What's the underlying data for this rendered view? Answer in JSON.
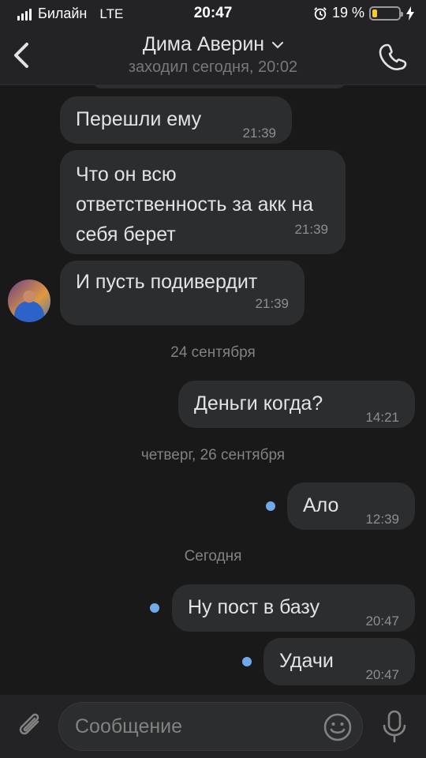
{
  "status_bar": {
    "carrier": "Билайн",
    "network": "LTE",
    "time": "20:47",
    "battery_percent": "19 %",
    "battery_level": 0.19
  },
  "header": {
    "title": "Дима Аверин",
    "subtitle": "заходил сегодня, 20:02"
  },
  "messages": [
    {
      "text": "Перешли ему",
      "time": "21:39",
      "direction": "incoming"
    },
    {
      "text": "Что он всю ответственность за акк на себя берет",
      "time": "21:39",
      "direction": "incoming"
    },
    {
      "text": "И пусть подивердит",
      "time": "21:39",
      "direction": "incoming"
    },
    {
      "date_label": "24 сентября"
    },
    {
      "text": "Деньги когда?",
      "time": "14:21",
      "direction": "outgoing"
    },
    {
      "date_label": "четверг, 26 сентября"
    },
    {
      "text": "Ало",
      "time": "12:39",
      "direction": "outgoing",
      "unread": true
    },
    {
      "date_label": "Сегодня"
    },
    {
      "text": "Ну пост в базу",
      "time": "20:47",
      "direction": "outgoing",
      "unread": true
    },
    {
      "text": "Удачи",
      "time": "20:47",
      "direction": "outgoing",
      "unread": true
    }
  ],
  "composer": {
    "placeholder": "Сообщение"
  },
  "colors": {
    "background": "#19191a",
    "bar": "#232325",
    "bubble": "#2c2d2f",
    "accent": "#71aaeb",
    "battery": "#f7c833"
  },
  "icons": [
    "back-icon",
    "chevron-down-icon",
    "phone-icon",
    "attach-icon",
    "emoji-icon",
    "mic-icon",
    "alarm-icon",
    "charging-icon"
  ]
}
